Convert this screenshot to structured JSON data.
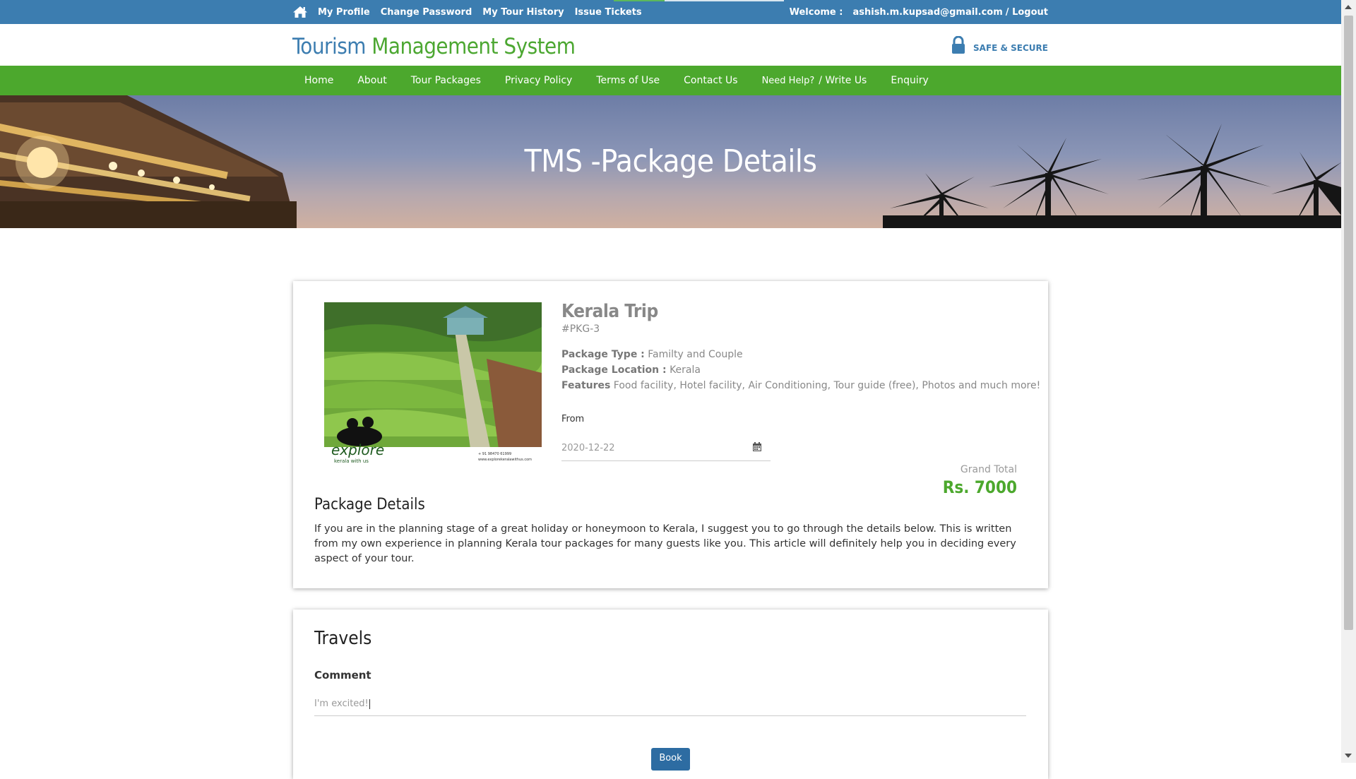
{
  "topbar": {
    "links": [
      "My Profile",
      "Change Password",
      "My Tour History",
      "Issue Tickets"
    ],
    "welcome_label": "Welcome :",
    "user_email": "ashish.m.kupsad@gmail.com",
    "logout_label": "/ Logout",
    "load_progress": 0.3
  },
  "header": {
    "brand_part1": "Tourism",
    "brand_part2": "Management System",
    "secure_label": "SAFE & SECURE"
  },
  "nav": {
    "items": [
      "Home",
      "About",
      "Tour Packages",
      "Privacy Policy",
      "Terms of Use",
      "Contact Us"
    ],
    "need_help": "Need Help?",
    "write_us": "/ Write Us",
    "enquiry": "Enquiry"
  },
  "banner": {
    "title": "TMS -Package Details"
  },
  "package": {
    "name": "Kerala Trip",
    "id": "#PKG-3",
    "type_label": "Package Type :",
    "type_value": "Familty and Couple",
    "location_label": "Package Location :",
    "location_value": "Kerala",
    "features_label": "Features",
    "features_value": "Food facility, Hotel facility, Air Conditioning, Tour guide (free), Photos and much more!",
    "from_label": "From",
    "from_date": "2020-12-22",
    "grand_total_label": "Grand Total",
    "grand_total_value": "Rs. 7000",
    "image_logo_text": "explore",
    "image_logo_sub": "kerala with us",
    "image_phone": "+ 91 98470 61999",
    "image_url": "www.explorekeralawithus.com",
    "details_title": "Package Details",
    "details_text": "If you are in the planning stage of a great holiday or honeymoon to Kerala, I suggest you to go through the details below. This is written from my own experience in planning Kerala tour packages for many guests like you. This article will definitely help you in deciding every aspect of your tour."
  },
  "travels": {
    "title": "Travels",
    "comment_label": "Comment",
    "comment_value": "I'm excited!",
    "book_label": "Book"
  },
  "colors": {
    "topbar": "#3c7db0",
    "nav": "#4ca82d",
    "brand_blue": "#3c7db0",
    "brand_green": "#4ca731",
    "price_green": "#4ca82d",
    "book_button": "#2d6ca2"
  },
  "icons": {
    "home": "home-icon",
    "lock": "lock-icon",
    "calendar": "calendar-icon"
  }
}
